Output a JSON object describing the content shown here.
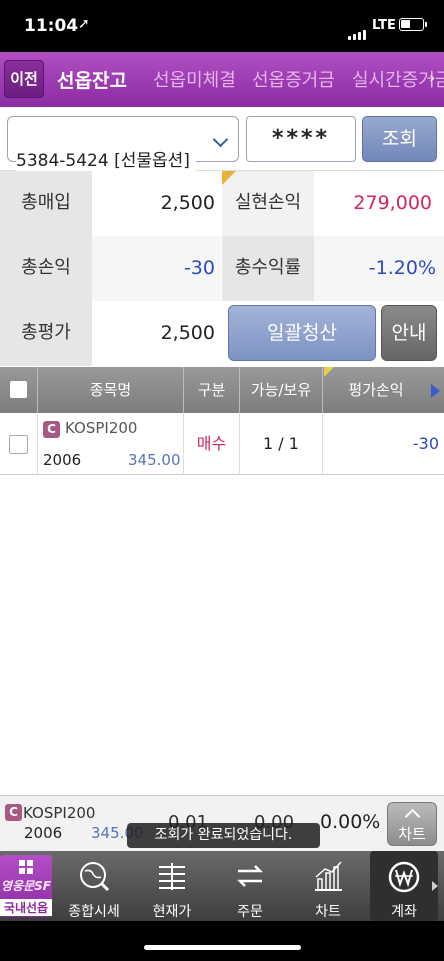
{
  "status_bar": {
    "time": "11:04",
    "network": "LTE"
  },
  "header": {
    "back_label": "이전",
    "tabs": [
      {
        "label": "선옵잔고",
        "active": true
      },
      {
        "label": "선옵미체결",
        "active": false
      },
      {
        "label": "선옵증거금",
        "active": false
      },
      {
        "label": "실시간증거금",
        "active": false
      }
    ],
    "more_icon": "chevron-right-icon"
  },
  "account": {
    "selected": "5384-5424 [선물옵션]",
    "password_mask": "****",
    "query_label": "조회"
  },
  "summary": {
    "total_buy_label": "총매입",
    "total_buy": "2,500",
    "realized_pl_label": "실현손익",
    "realized_pl": "279,000",
    "total_pl_label": "총손익",
    "total_pl": "-30",
    "total_return_label": "총수익률",
    "total_return": "-1.20%",
    "total_eval_label": "총평가",
    "total_eval": "2,500",
    "liquidate_label": "일괄청산",
    "guide_label": "안내"
  },
  "table": {
    "headers": [
      "종목명",
      "구분",
      "가능/보유",
      "평가손익"
    ],
    "rows": [
      {
        "badge": "C",
        "name": "KOSPI200",
        "month": "2006",
        "price": "345.00",
        "side": "매수",
        "position": "1 / 1",
        "eval_pl": "-30"
      }
    ]
  },
  "ticker": {
    "badge": "C",
    "name": "KOSPI200",
    "month": "2006",
    "price": "345.00",
    "v1": "0.01",
    "v2": "0.00",
    "v3": "0.00%",
    "chart_label": "차트"
  },
  "toast": "조회가 완료되었습니다.",
  "bottom_nav": {
    "home_logo": "영웅문SF",
    "home_label": "국내선옵",
    "items": [
      {
        "label": "종합시세",
        "icon": "globe-search-icon"
      },
      {
        "label": "현재가",
        "icon": "price-bars-icon"
      },
      {
        "label": "주문",
        "icon": "order-arrows-icon"
      },
      {
        "label": "차트",
        "icon": "chart-icon"
      },
      {
        "label": "계좌",
        "icon": "won-icon",
        "active": true
      }
    ]
  },
  "colors": {
    "header_purple": "#9b3bb2",
    "profit_red": "#d0285a",
    "loss_blue": "#2b4db8",
    "button_blue": "#7e93c4"
  }
}
